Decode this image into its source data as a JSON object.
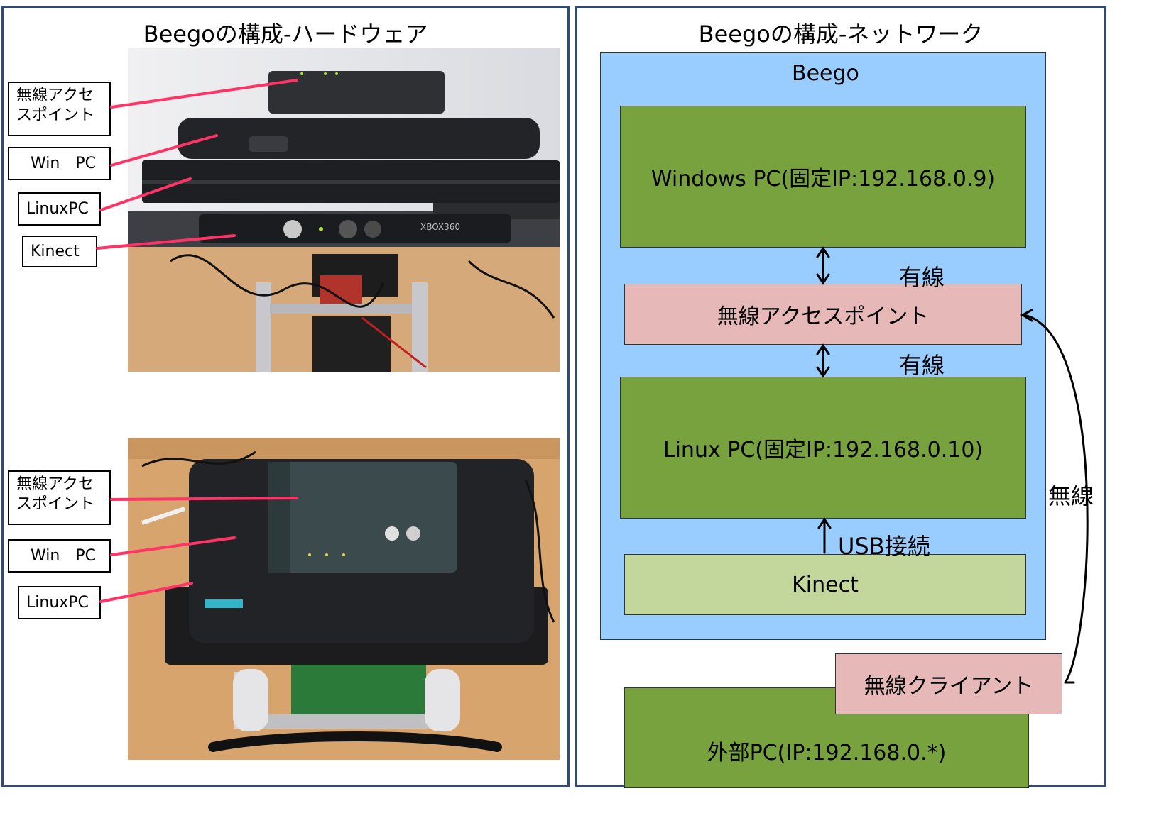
{
  "hardware_panel": {
    "title": "Beegoの構成-ハードウェア",
    "top_labels": {
      "access_point": "無線アクセスポイント",
      "win_pc": "Win　PC",
      "linux_pc": "LinuxPC",
      "kinect": "Kinect"
    },
    "bottom_labels": {
      "access_point": "無線アクセスポイント",
      "win_pc": "Win　PC",
      "linux_pc": "LinuxPC"
    },
    "kinect_brand_text": "XBOX360"
  },
  "network_panel": {
    "title": "Beegoの構成-ネットワーク",
    "beego_label": "Beego",
    "windows_pc": "Windows PC(固定IP:192.168.0.9)",
    "access_point": "無線アクセスポイント",
    "linux_pc": "Linux PC(固定IP:192.168.0.10)",
    "kinect": "Kinect",
    "wired_1": "有線",
    "wired_2": "有線",
    "usb": "USB接続",
    "wireless": "無線",
    "client": "無線クライアント",
    "external_pc": "外部PC(IP:192.168.0.*)"
  },
  "colors": {
    "beego_background": "#99ccff",
    "pc_box": "#77a23e",
    "kinect_box": "#c3d69b",
    "access_point_box": "#e6b9b8",
    "label_line": "#ff3366",
    "panel_border": "#2f4a74"
  }
}
